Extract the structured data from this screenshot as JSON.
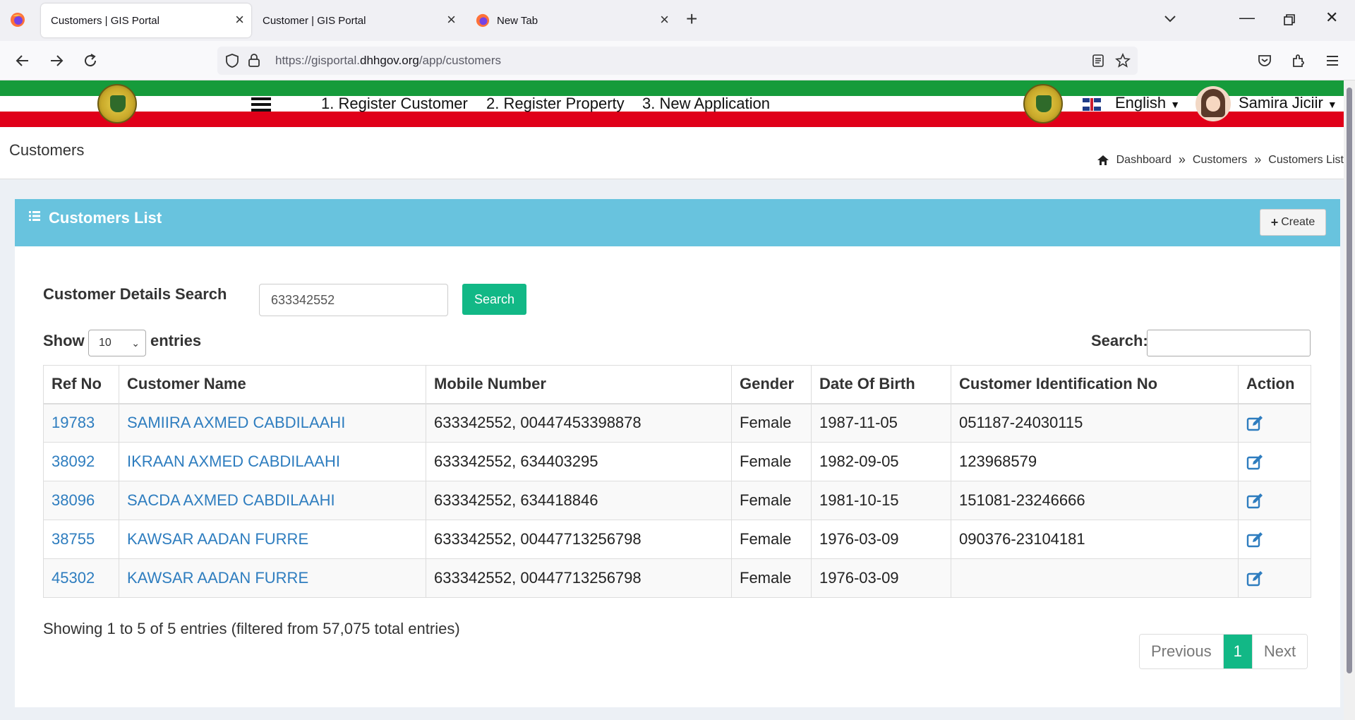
{
  "browser": {
    "tabs": [
      {
        "title": "Customers | GIS Portal",
        "active": true
      },
      {
        "title": "Customer | GIS Portal",
        "active": false
      },
      {
        "title": "New Tab",
        "active": false
      }
    ],
    "url_prefix": "https://gisportal.",
    "url_domain": "dhhgov.org",
    "url_path": "/app/customers"
  },
  "header": {
    "menu": [
      "1. Register Customer",
      "2. Register Property",
      "3. New Application"
    ],
    "language": "English",
    "user_name": "Samira Jiciir",
    "colors": {
      "green": "#169b3b",
      "red": "#e00019"
    }
  },
  "page": {
    "title": "Customers",
    "breadcrumb": [
      "Dashboard",
      "Customers",
      "Customers List"
    ]
  },
  "box": {
    "title": "Customers List",
    "create_label": "Create",
    "accent": "#68c3de"
  },
  "search": {
    "label": "Customer Details Search",
    "value": "633342552",
    "button_label": "Search"
  },
  "table_controls": {
    "show_label": "Show",
    "entries_value": "10",
    "entries_label": "entries",
    "search_label": "Search:"
  },
  "table": {
    "headers": [
      "Ref No",
      "Customer Name",
      "Mobile Number",
      "Gender",
      "Date Of Birth",
      "Customer Identification No",
      "Action"
    ],
    "rows": [
      {
        "ref": "19783",
        "name": "SAMIIRA AXMED CABDILAAHI",
        "mobile": "633342552, 00447453398878",
        "gender": "Female",
        "dob": "1987-11-05",
        "idno": "051187-24030115"
      },
      {
        "ref": "38092",
        "name": "IKRAAN AXMED CABDILAAHI",
        "mobile": "633342552, 634403295",
        "gender": "Female",
        "dob": "1982-09-05",
        "idno": "123968579"
      },
      {
        "ref": "38096",
        "name": "SACDA AXMED CABDILAAHI",
        "mobile": "633342552, 634418846",
        "gender": "Female",
        "dob": "1981-10-15",
        "idno": "151081-23246666"
      },
      {
        "ref": "38755",
        "name": "KAWSAR AADAN FURRE",
        "mobile": "633342552, 00447713256798",
        "gender": "Female",
        "dob": "1976-03-09",
        "idno": "090376-23104181"
      },
      {
        "ref": "45302",
        "name": "KAWSAR AADAN FURRE",
        "mobile": "633342552, 00447713256798",
        "gender": "Female",
        "dob": "1976-03-09",
        "idno": ""
      }
    ]
  },
  "footer": {
    "showing": "Showing 1 to 5 of 5 entries (filtered from 57,075 total entries)",
    "previous": "Previous",
    "page": "1",
    "next": "Next"
  }
}
